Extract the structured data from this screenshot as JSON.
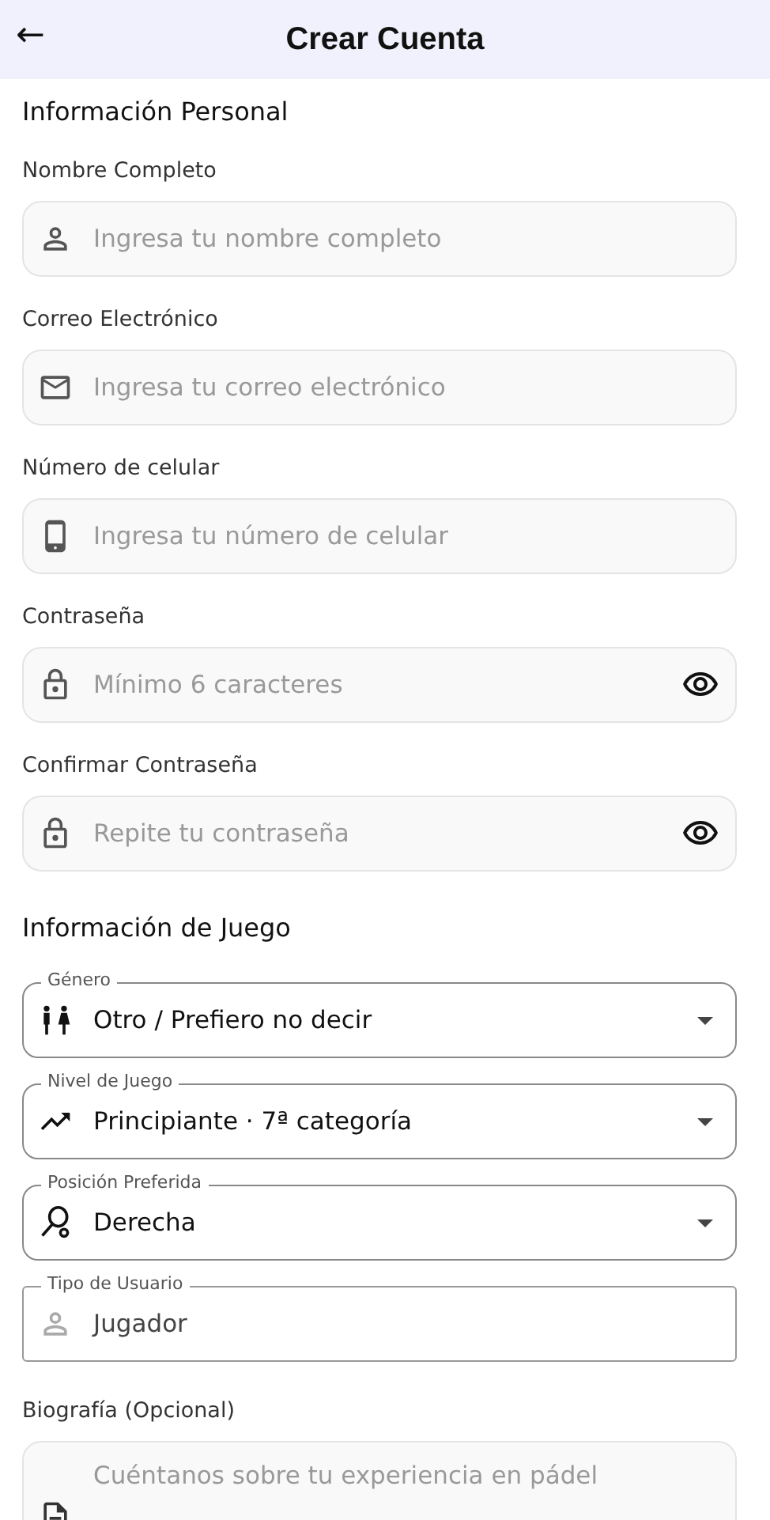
{
  "header": {
    "back": "←",
    "title": "Crear Cuenta"
  },
  "personal": {
    "title": "Información Personal",
    "fields": [
      {
        "kind": "text",
        "label": "Nombre Completo",
        "placeholder": "Ingresa tu nombre completo"
      },
      {
        "kind": "text",
        "label": "Correo Electrónico",
        "placeholder": "Ingresa tu correo electrónico"
      },
      {
        "kind": "text",
        "label": "Número de celular",
        "placeholder": "Ingresa tu número de celular"
      },
      {
        "kind": "password",
        "label": "Contraseña",
        "placeholder": "Mínimo 6 caracteres"
      },
      {
        "kind": "password",
        "label": "Confirmar Contraseña",
        "placeholder": "Repite tu contraseña"
      }
    ]
  },
  "game": {
    "title": "Información de Juego",
    "fields": [
      {
        "kind": "select",
        "label": "Género",
        "value": "Otro / Prefiero no decir",
        "disabled": false
      },
      {
        "kind": "select",
        "label": "Nivel de Juego",
        "value": "Principiante · 7ª categoría",
        "disabled": false
      },
      {
        "kind": "select",
        "label": "Posición Preferida",
        "value": "Derecha",
        "disabled": false
      },
      {
        "kind": "readonly",
        "label": "Tipo de Usuario",
        "value": "Jugador",
        "disabled": true
      }
    ]
  },
  "bio": {
    "label": "Biografía (Opcional)",
    "placeholder": "Cuéntanos sobre tu experiencia en pádel"
  }
}
